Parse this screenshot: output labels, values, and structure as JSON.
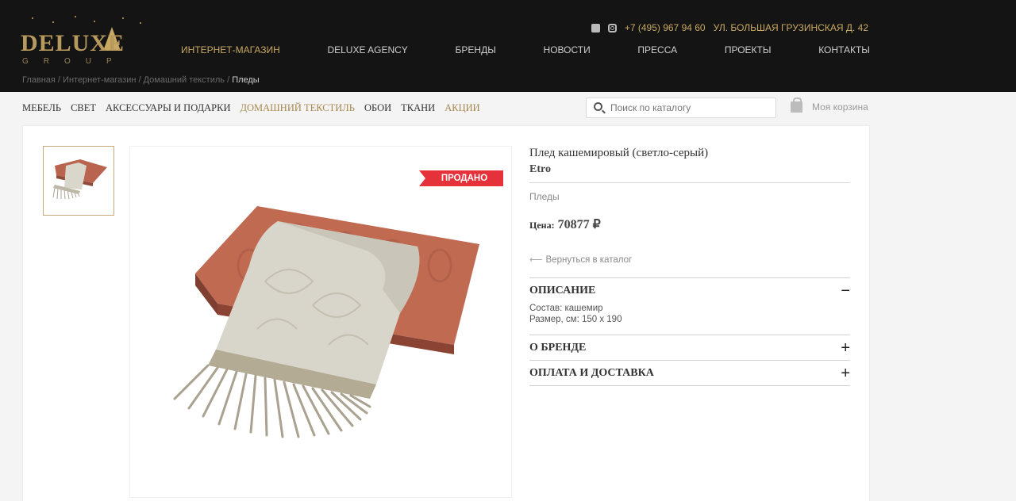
{
  "header": {
    "logo_word": "DELUXE",
    "logo_sub": "GROUP",
    "phone": "+7 (495) 967 94 60",
    "address": "УЛ. БОЛЬШАЯ ГРУЗИНСКАЯ Д. 42",
    "icons": [
      "facebook-icon",
      "instagram-icon"
    ],
    "nav": [
      "ИНТЕРНЕТ-МАГАЗИН",
      "DELUXE AGENCY",
      "БРЕНДЫ",
      "НОВОСТИ",
      "ПРЕССА",
      "ПРОЕКТЫ",
      "КОНТАКТЫ"
    ]
  },
  "breadcrumb": {
    "items": [
      "Главная",
      "Интернет-магазин",
      "Домашний текстиль"
    ],
    "separator": " / ",
    "current": "Пледы"
  },
  "categories": [
    "МЕБЕЛЬ",
    "СВЕТ",
    "АКСЕССУАРЫ И ПОДАРКИ",
    "ДОМАШНИЙ ТЕКСТИЛЬ",
    "ОБОИ",
    "ТКАНИ",
    "АКЦИИ"
  ],
  "search": {
    "placeholder": "Поиск по каталогу"
  },
  "cart": {
    "label": "Моя корзина"
  },
  "product": {
    "badge": "ПРОДАНО",
    "title": "Плед кашемировый (светло-серый)",
    "brand": "Etro",
    "category": "Пледы",
    "price_label": "Цена:",
    "price_value": "70877 ₽",
    "back_label": "Вернуться в каталог",
    "sections": [
      {
        "title": "ОПИСАНИЕ",
        "toggle": "−",
        "lines": [
          "Состав: кашемир",
          "Размер, см: 150 x 190"
        ]
      },
      {
        "title": "О БРЕНДЕ",
        "toggle": "+"
      },
      {
        "title": "ОПЛАТА И ДОСТАВКА",
        "toggle": "+"
      }
    ]
  },
  "colors": {
    "accent": "#c9a961",
    "sold": "#e4313a",
    "header_bg": "#141414"
  }
}
